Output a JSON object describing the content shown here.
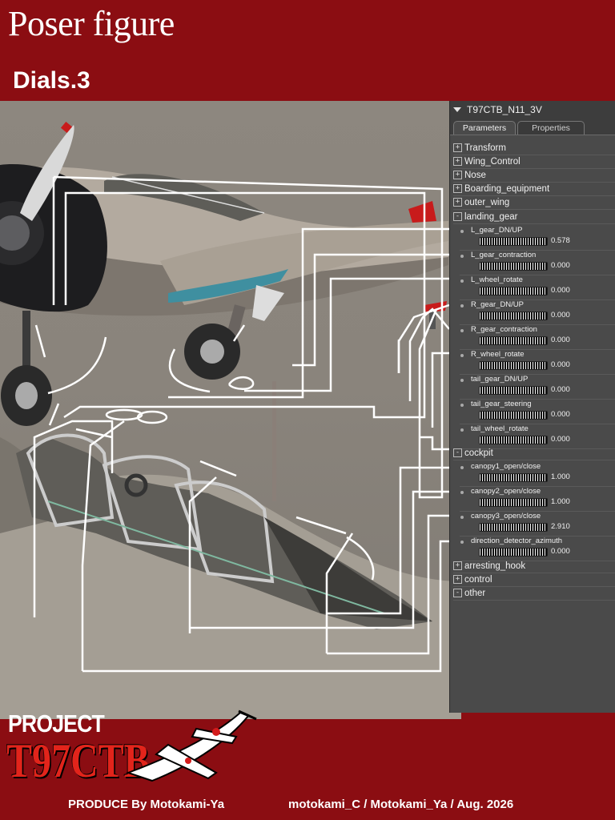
{
  "header": {
    "title": "Poser figure",
    "subtitle": "Dials.3"
  },
  "panel": {
    "figure_name": "T97CTB_N11_3V",
    "tabs": [
      {
        "label": "Parameters",
        "active": true
      },
      {
        "label": "Properties",
        "active": false
      }
    ],
    "groups_top": [
      {
        "label": "Transform",
        "icon": "+"
      },
      {
        "label": "Wing_Control",
        "icon": "+"
      },
      {
        "label": "Nose",
        "icon": "+"
      },
      {
        "label": "Boarding_equipment",
        "icon": "+"
      },
      {
        "label": "outer_wing",
        "icon": "+"
      },
      {
        "label": "landing_gear",
        "icon": "-"
      }
    ],
    "landing_gear_dials": [
      {
        "label": "L_gear_DN/UP",
        "value": "0.578"
      },
      {
        "label": "L_gear_contraction",
        "value": "0.000"
      },
      {
        "label": "L_wheel_rotate",
        "value": "0.000"
      },
      {
        "label": "R_gear_DN/UP",
        "value": "0.000"
      },
      {
        "label": "R_gear_contraction",
        "value": "0.000"
      },
      {
        "label": "R_wheel_rotate",
        "value": "0.000"
      },
      {
        "label": "tail_gear_DN/UP",
        "value": "0.000"
      },
      {
        "label": "tail_gear_steering",
        "value": "0.000"
      },
      {
        "label": "tail_wheel_rotate",
        "value": "0.000"
      }
    ],
    "cockpit_group": {
      "label": "cockpit",
      "icon": "-"
    },
    "cockpit_dials": [
      {
        "label": "canopy1_open/close",
        "value": "1.000"
      },
      {
        "label": "canopy2_open/close",
        "value": "1.000"
      },
      {
        "label": "canopy3_open/close",
        "value": "2.910"
      },
      {
        "label": "direction_detector_azimuth",
        "value": "0.000"
      }
    ],
    "groups_bottom": [
      {
        "label": "arresting_hook",
        "icon": "+"
      },
      {
        "label": "control",
        "icon": "+"
      },
      {
        "label": "other",
        "icon": "-"
      }
    ]
  },
  "footer": {
    "logo_line1": "PROJECT",
    "logo_line2": "T97CTB",
    "credit_left": "PRODUCE By Motokami-Ya",
    "credit_right": "motokami_C / Motokami_Ya / Aug. 2026"
  },
  "colors": {
    "brand_red": "#8b0d12",
    "panel_bg": "#4a4a4a",
    "annotation": "#ffffff"
  }
}
